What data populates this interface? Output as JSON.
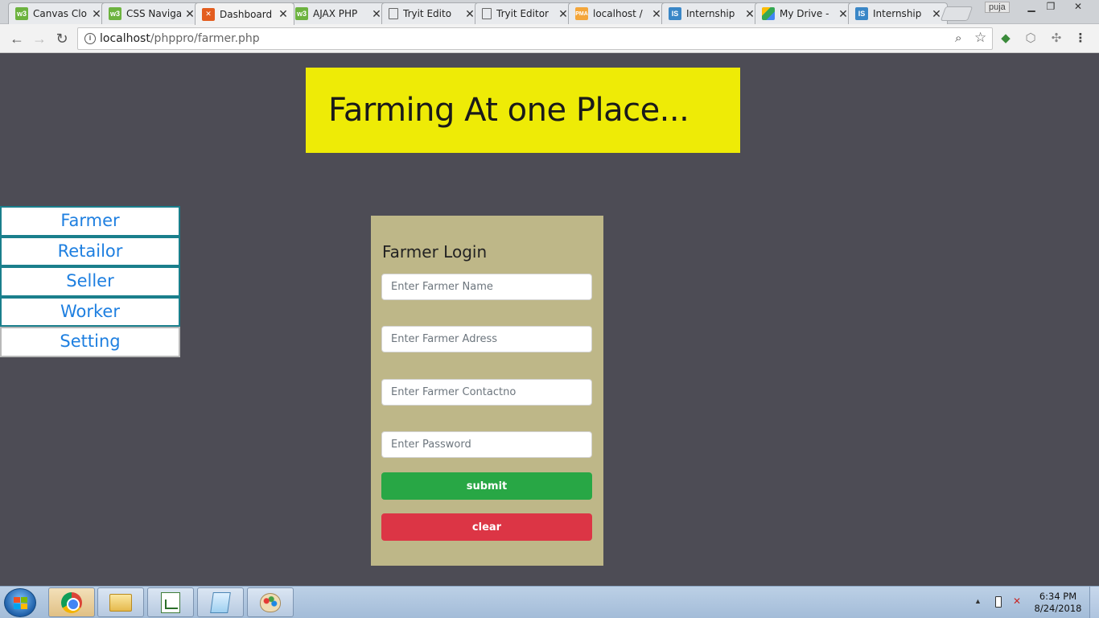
{
  "browser": {
    "tabs": [
      {
        "title": "Canvas Clo",
        "icon": "w3schools-icon",
        "active": false
      },
      {
        "title": "CSS Naviga",
        "icon": "w3schools-icon",
        "active": false
      },
      {
        "title": "Dashboard",
        "icon": "xampp-icon",
        "active": true
      },
      {
        "title": "AJAX PHP",
        "icon": "w3schools-icon",
        "active": false
      },
      {
        "title": "Tryit Edito",
        "icon": "document-icon",
        "active": false
      },
      {
        "title": "Tryit Editor",
        "icon": "document-icon",
        "active": false
      },
      {
        "title": "localhost /",
        "icon": "phpmyadmin-icon",
        "active": false
      },
      {
        "title": "Internship",
        "icon": "internshala-icon",
        "active": false
      },
      {
        "title": "My Drive -",
        "icon": "google-drive-icon",
        "active": false
      },
      {
        "title": "Internship",
        "icon": "internshala-icon",
        "active": false
      }
    ],
    "profile_name": "puja",
    "url_host": "localhost",
    "url_path": "/phppro/farmer.php"
  },
  "page": {
    "banner_title": "Farming At one Place...",
    "nav": [
      "Farmer",
      "Retailor",
      "Seller",
      "Worker",
      "Setting"
    ],
    "login": {
      "heading": "Farmer Login",
      "name_placeholder": "Enter Farmer Name",
      "address_placeholder": "Enter Farmer Adress",
      "contact_placeholder": "Enter Farmer Contactno",
      "password_placeholder": "Enter Password",
      "submit_label": "submit",
      "clear_label": "clear"
    }
  },
  "taskbar": {
    "time": "6:34 PM",
    "date": "8/24/2018"
  },
  "colors": {
    "page_bg": "#4d4c55",
    "banner_bg": "#eeeb06",
    "login_bg": "#beb788",
    "submit_bg": "#28a745",
    "clear_bg": "#dc3545",
    "nav_text": "#1e7fe0",
    "nav_border": "#1a7f8c"
  }
}
